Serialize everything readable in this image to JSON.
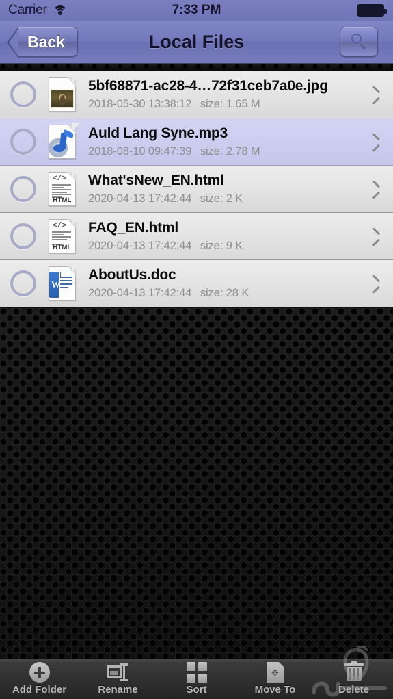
{
  "status_bar": {
    "carrier": "Carrier",
    "wifi_icon": "wifi-icon",
    "time": "7:33 PM",
    "battery_icon": "battery-full-icon"
  },
  "nav_bar": {
    "back_label": "Back",
    "title": "Local Files",
    "search_icon": "search-icon"
  },
  "files": [
    {
      "name": "5bf68871-ac28-4…72f31ceb7a0e.jpg",
      "date": "2018-05-30 13:38:12",
      "size": "size: 1.65 M",
      "icon": "image-file-icon",
      "selected": false,
      "checked": false
    },
    {
      "name": "Auld Lang Syne.mp3",
      "date": "2018-08-10 09:47:39",
      "size": "size: 2.78 M",
      "icon": "audio-file-icon",
      "selected": true,
      "checked": false
    },
    {
      "name": "What'sNew_EN.html",
      "date": "2020-04-13 17:42:44",
      "size": "size: 2 K",
      "icon": "html-file-icon",
      "selected": false,
      "checked": false
    },
    {
      "name": "FAQ_EN.html",
      "date": "2020-04-13 17:42:44",
      "size": "size: 9 K",
      "icon": "html-file-icon",
      "selected": false,
      "checked": false
    },
    {
      "name": "AboutUs.doc",
      "date": "2020-04-13 17:42:44",
      "size": "size: 28 K",
      "icon": "word-file-icon",
      "selected": false,
      "checked": false
    }
  ],
  "toolbar": {
    "items": [
      {
        "label": "Add Folder",
        "icon": "add-folder-icon"
      },
      {
        "label": "Rename",
        "icon": "rename-icon"
      },
      {
        "label": "Sort",
        "icon": "sort-grid-icon"
      },
      {
        "label": "Move To",
        "icon": "move-to-icon"
      },
      {
        "label": "Delete",
        "icon": "trash-icon"
      }
    ]
  },
  "html_icon": {
    "tag": "</>",
    "label": "HTML"
  },
  "word_icon": {
    "letter": "W"
  },
  "move_icon": {
    "glyph": "✥"
  },
  "colors": {
    "nav_bar": "#7378bb",
    "status_bar": "#7478ba",
    "row_selected": "#cdcdef",
    "row_normal": "#e4e4e4",
    "body_background": "#141414",
    "toolbar": "#2f2f2f",
    "checkbox_border": "#a9aac8",
    "subtitle_text": "#8e8e8e"
  }
}
